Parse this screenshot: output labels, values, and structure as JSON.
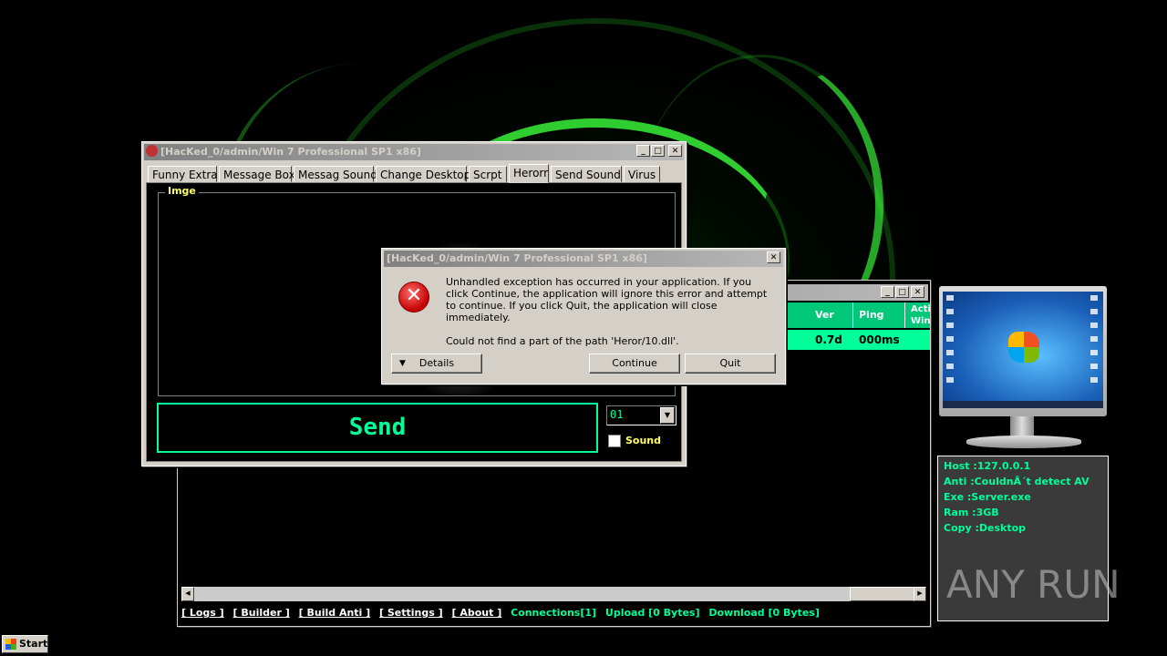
{
  "main_window": {
    "columns": [
      "Ver",
      "Ping",
      "Acti Win"
    ],
    "row": {
      "ver": "0.7d",
      "ping": "000ms"
    },
    "status_links": [
      "[ Logs ]",
      "[ Builder ]",
      "[ Build Anti ]",
      "[ Settings ]",
      "[ About ]"
    ],
    "status_info": [
      "Connections[1]",
      "Upload [0 Bytes]",
      "Download [0 Bytes]"
    ]
  },
  "hack_window": {
    "title": "[HacKed_0/admin/Win 7 Professional SP1 x86]",
    "tabs": [
      "Funny Extra",
      "Message Box",
      "Messag Sound",
      "Change Desktop",
      "Scrpt",
      "Herorr",
      "Send Sound",
      "Virus"
    ],
    "active_tab": "Herorr",
    "image_group_label": "Imge",
    "send_label": "Send",
    "combo_value": "01",
    "sound_label": "Sound"
  },
  "error_dialog": {
    "title": "[HacKed_0/admin/Win 7 Professional SP1 x86]",
    "message": "Unhandled exception has occurred in your application. If you click Continue, the application will ignore this error and attempt to continue. If you click Quit, the application will close immediately.",
    "detail": "Could not find a part of the path 'Heror/10.dll'.",
    "details_label": "Details",
    "continue_label": "Continue",
    "quit_label": "Quit"
  },
  "info_panel": {
    "host": "Host :127.0.0.1",
    "anti": "Anti :CouldnÂ´t detect AV",
    "exe": "Exe  :Server.exe",
    "ram": "Ram  :3GB",
    "copy": "Copy :Desktop"
  },
  "watermark": "ANY RUN",
  "taskbar": {
    "start_label": "Start"
  },
  "colors": {
    "accent_green": "#00ff99",
    "header_green": "#00c878",
    "label_yellow": "#ffff66",
    "dialog_gray": "#d4d0c8"
  }
}
